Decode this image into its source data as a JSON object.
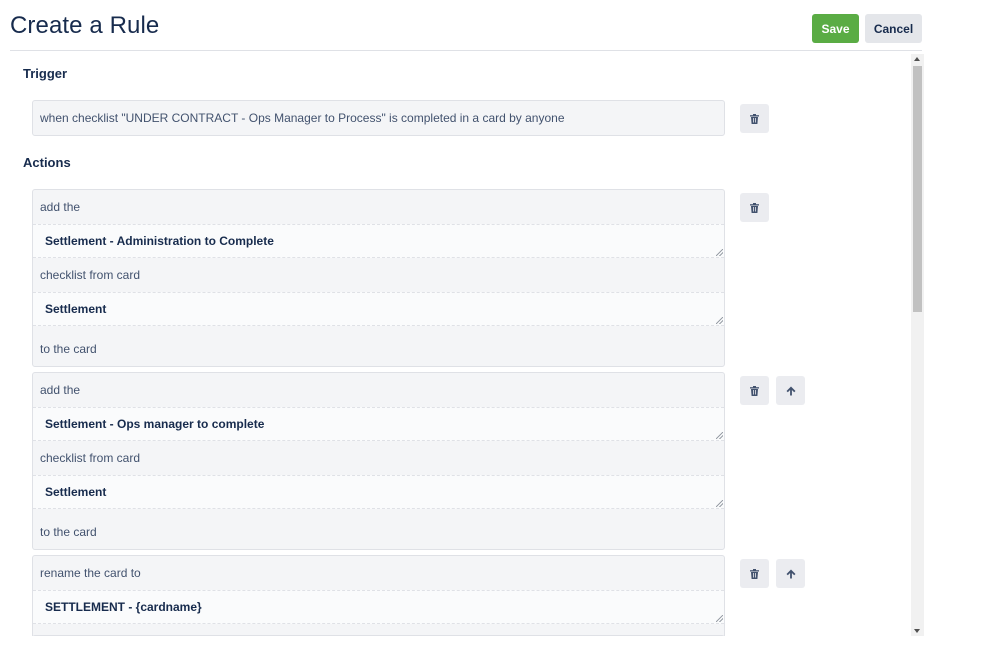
{
  "header": {
    "title": "Create a Rule",
    "save_label": "Save",
    "cancel_label": "Cancel"
  },
  "trigger": {
    "section_label": "Trigger",
    "text": "when checklist \"UNDER CONTRACT - Ops Manager to Process\" is completed in a card by anyone"
  },
  "actions": {
    "section_label": "Actions",
    "items": [
      {
        "prefix": "add the",
        "field1": "Settlement - Administration to Complete",
        "middle": "checklist from card",
        "field2": "Settlement",
        "suffix": "to the card"
      },
      {
        "prefix": "add the",
        "field1": "Settlement - Ops manager to complete",
        "middle": "checklist from card",
        "field2": "Settlement",
        "suffix": "to the card"
      },
      {
        "prefix": "rename the card to",
        "field1": "SETTLEMENT - {cardname}"
      }
    ]
  },
  "icons": {
    "delete": "trash-icon",
    "move_up": "arrow-up-icon"
  },
  "colors": {
    "primary": "#5aac44",
    "title": "#172b4d",
    "secondary_button": "#e4e6ea"
  }
}
